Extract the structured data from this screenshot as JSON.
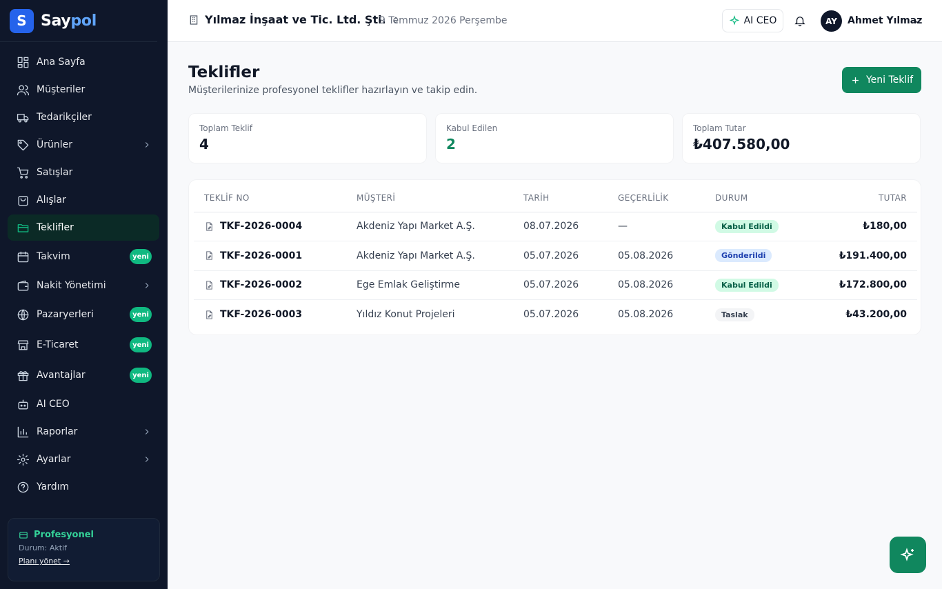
{
  "brand": {
    "logo_letter": "S",
    "name_part1": "Say",
    "name_part2": "pol"
  },
  "sidebar": {
    "items": [
      {
        "label": "Ana Sayfa",
        "icon": "dashboard-icon"
      },
      {
        "label": "Müşteriler",
        "icon": "users-icon"
      },
      {
        "label": "Tedarikçiler",
        "icon": "truck-icon"
      },
      {
        "label": "Ürünler",
        "icon": "tag-icon",
        "has_children": true
      },
      {
        "label": "Satışlar",
        "icon": "cart-icon"
      },
      {
        "label": "Alışlar",
        "icon": "bag-icon"
      },
      {
        "label": "Teklifler",
        "icon": "folder-icon",
        "active": true
      },
      {
        "label": "Takvim",
        "icon": "calendar-icon",
        "badge": "yeni"
      },
      {
        "label": "Nakit Yönetimi",
        "icon": "wallet-icon",
        "has_children": true
      },
      {
        "label": "Pazaryerleri",
        "icon": "globe-icon",
        "badge": "yeni"
      },
      {
        "label": "E-Ticaret",
        "icon": "store-icon",
        "badge": "yeni"
      },
      {
        "label": "Avantajlar",
        "icon": "gift-icon",
        "badge": "yeni"
      },
      {
        "label": "AI CEO",
        "icon": "bot-icon"
      },
      {
        "label": "Raporlar",
        "icon": "chart-icon",
        "has_children": true
      },
      {
        "label": "Ayarlar",
        "icon": "gear-icon",
        "has_children": true
      },
      {
        "label": "Yardım",
        "icon": "help-icon"
      }
    ],
    "plan": {
      "title": "Profesyonel",
      "status": "Durum: Aktif",
      "link": "Planı yönet →"
    }
  },
  "topbar": {
    "company": "Yılmaz İnşaat ve Tic. Ltd. Şti.",
    "date": "9 Temmuz 2026 Perşembe",
    "ai_button": "AI CEO",
    "user_initials": "AY",
    "user_name": "Ahmet Yılmaz"
  },
  "page": {
    "title": "Teklifler",
    "subtitle": "Müşterilerinize profesyonel teklifler hazırlayın ve takip edin.",
    "new_button": "Yeni Teklif"
  },
  "stats": [
    {
      "label": "Toplam Teklif",
      "value": "4"
    },
    {
      "label": "Kabul Edilen",
      "value": "2"
    },
    {
      "label": "Toplam Tutar",
      "value": "₺407.580,00"
    }
  ],
  "table": {
    "headers": [
      "TEKLİF NO",
      "MÜŞTERİ",
      "TARİH",
      "GEÇERLİLİK",
      "DURUM",
      "TUTAR"
    ],
    "rows": [
      {
        "no": "TKF-2026-0004",
        "customer": "Akdeniz Yapı Market A.Ş.",
        "date": "08.07.2026",
        "validity": "—",
        "status": "Kabul Edildi",
        "amount": "₺180,00"
      },
      {
        "no": "TKF-2026-0001",
        "customer": "Akdeniz Yapı Market A.Ş.",
        "date": "05.07.2026",
        "validity": "05.08.2026",
        "status": "Gönderildi",
        "amount": "₺191.400,00"
      },
      {
        "no": "TKF-2026-0002",
        "customer": "Ege Emlak Geliştirme",
        "date": "05.07.2026",
        "validity": "05.08.2026",
        "status": "Kabul Edildi",
        "amount": "₺172.800,00"
      },
      {
        "no": "TKF-2026-0003",
        "customer": "Yıldız Konut Projeleri",
        "date": "05.07.2026",
        "validity": "05.08.2026",
        "status": "Taslak",
        "amount": "₺43.200,00"
      }
    ]
  },
  "colors": {
    "accent": "#10875e",
    "sidebar_bg": "#0f172a",
    "brand_blue": "#2563eb"
  }
}
